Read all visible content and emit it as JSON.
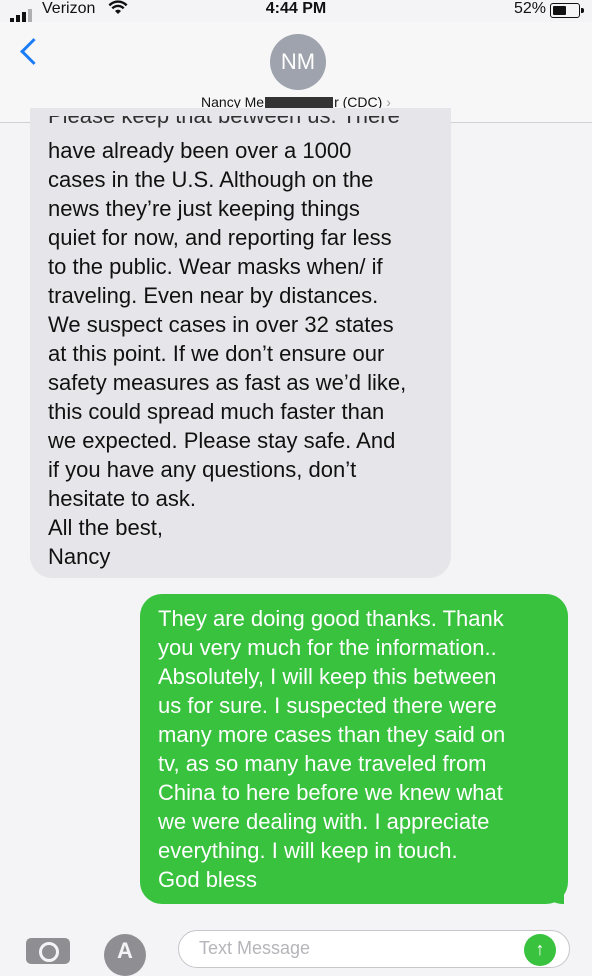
{
  "status": {
    "carrier": "Verizon",
    "time": "4:44 PM",
    "battery": "52%"
  },
  "header": {
    "avatar_initials": "NM",
    "contact_prefix": "Nancy Me",
    "contact_suffix": "r (CDC)",
    "chevron": "›"
  },
  "messages": {
    "incoming": {
      "cut_line": "Please keep that between us. There",
      "text": "have already been over a 1000\ncases in the U.S. Although on the\nnews they’re just keeping things\nquiet for now, and reporting far less\nto the public. Wear masks when/ if\ntraveling. Even near by distances.\nWe suspect cases in over 32 states\nat this point. If we don’t ensure our\nsafety measures as fast as we’d like,\nthis could spread much faster than\nwe expected. Please stay safe. And\nif you have any questions, don’t\nhesitate to ask.\nAll the best,\nNancy"
    },
    "outgoing": {
      "text": "They are doing good thanks. Thank\nyou very much for the information..\nAbsolutely, I will keep this between\nus for sure. I suspected there were\nmany more cases than they said on\ntv, as so many have traveled from\nChina to here before we knew what\nwe were dealing with. I appreciate\neverything. I will keep in touch.\nGod bless"
    }
  },
  "composer": {
    "placeholder": "Text Message",
    "appstore_glyph": "A",
    "send_glyph": "↑"
  },
  "colors": {
    "accent_blue": "#1b7cf5",
    "sms_green": "#38c23e",
    "incoming_gray": "#e6e6ea"
  }
}
